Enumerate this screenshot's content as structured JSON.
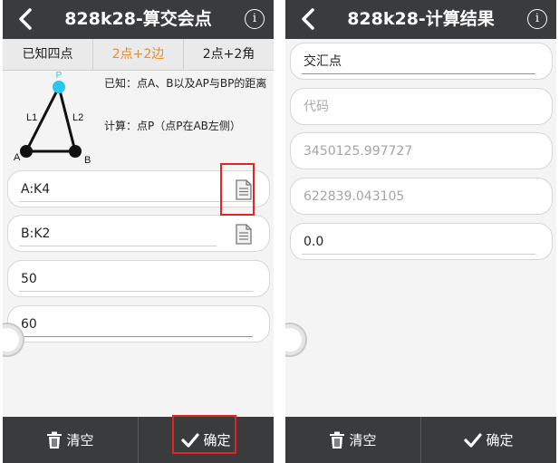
{
  "left": {
    "title": "828k28-算交会点",
    "info_glyph": "i",
    "tabs": [
      {
        "label": "已知四点",
        "active": false
      },
      {
        "label": "2点+2边",
        "active": true
      },
      {
        "label": "2点+2角",
        "active": false
      }
    ],
    "diagram": {
      "point_p": "P",
      "point_a": "A",
      "point_b": "B",
      "edge_l1": "L1",
      "edge_l2": "L2",
      "known_text": "已知：点A、B以及AP与BP的距离",
      "calc_text": "计算：点P（点P在AB左侧）"
    },
    "fields": {
      "point_a": "A:K4",
      "point_b": "B:K2",
      "dist_ap": "50",
      "dist_bp": "60"
    },
    "bottom": {
      "clear_label": "清空",
      "confirm_label": "确定"
    }
  },
  "right": {
    "title": "828k28-计算结果",
    "info_glyph": "i",
    "fields": {
      "point_name": "交汇点",
      "code_placeholder": "代码",
      "x_value": "3450125.997727",
      "y_value": "622839.043105",
      "z_value": "0.0"
    },
    "bottom": {
      "clear_label": "清空",
      "confirm_label": "确定"
    }
  },
  "colors": {
    "bar_bg": "#3a3b3d",
    "active_tab": "#ef8a22",
    "highlight_box": "#e12424",
    "point_p": "#29c6f0",
    "focus_line": "#3db4e0"
  },
  "icons": [
    "back-arrow-icon",
    "info-icon",
    "document-icon",
    "trash-icon",
    "checkmark-icon"
  ]
}
